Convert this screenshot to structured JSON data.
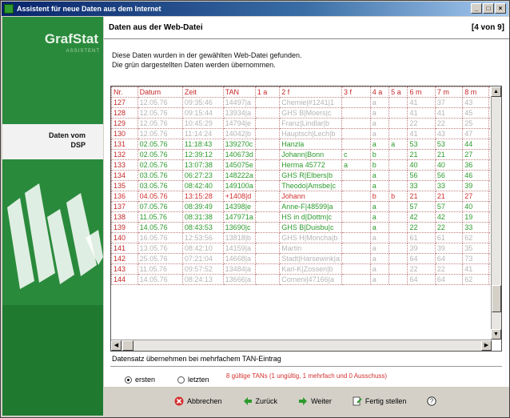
{
  "window": {
    "title": "Assistent für neue Daten aus dem Internet"
  },
  "sidebar": {
    "brand": "GrafStat",
    "sub": "ASSISTENT",
    "nav": [
      "Daten vom",
      "DSP"
    ]
  },
  "header": {
    "title": "Daten aus der Web-Datei",
    "step": "[4 von 9]"
  },
  "intro": {
    "line1": "Diese Daten wurden in der gewählten Web-Datei gefunden.",
    "line2": "Die grün dargestellten Daten werden übernommen."
  },
  "table": {
    "columns": [
      "Nr.",
      "Datum",
      "Zeit",
      "TAN",
      "1 a",
      "2 f",
      "3 f",
      "4 a",
      "5 a",
      "6 m",
      "7 m",
      "8 m",
      "9"
    ],
    "rows": [
      {
        "style": "grey",
        "cells": [
          "127",
          "12.05.76",
          "09:35:46",
          "14497|a",
          "",
          "Chemie|#1241|1",
          "",
          "a",
          "",
          "41",
          "37",
          "43",
          "4"
        ]
      },
      {
        "style": "grey",
        "cells": [
          "128",
          "12.05.76",
          "09:15:44",
          "13934|a",
          "",
          "GHS B|Moers|c",
          "",
          "a",
          "",
          "41",
          "41",
          "45",
          "4"
        ]
      },
      {
        "style": "grey",
        "cells": [
          "129",
          "12.05.76",
          "10:45:29",
          "14794|e",
          "",
          "Franz|Lindlar|b",
          "",
          "a",
          "",
          "22",
          "22",
          "25",
          "2"
        ]
      },
      {
        "style": "grey",
        "cells": [
          "130",
          "12.05.76",
          "11:14:24",
          "14042|b",
          "",
          "Hauptsch|Lech|b",
          "",
          "a",
          "",
          "41",
          "43",
          "47",
          "4"
        ]
      },
      {
        "style": "green",
        "cells": [
          "131",
          "02.05.76",
          "11:18:43",
          "139270c",
          "",
          "Hanzla",
          "",
          "a",
          "a",
          "53",
          "53",
          "44",
          "44"
        ]
      },
      {
        "style": "green",
        "cells": [
          "132",
          "02.05.76",
          "12:39:12",
          "140673d",
          "",
          "Johann|Bonn",
          "c",
          "b",
          "",
          "21",
          "21",
          "27",
          "0"
        ]
      },
      {
        "style": "green",
        "cells": [
          "133",
          "02.05.76",
          "13:07:38",
          "145075e",
          "",
          "Herma 45772",
          "a",
          "b",
          "",
          "40",
          "40",
          "36",
          "0"
        ]
      },
      {
        "style": "green",
        "cells": [
          "134",
          "03.05.76",
          "06:27:23",
          "148222a",
          "",
          "GHS R|Elbers|b",
          "",
          "a",
          "",
          "56",
          "56",
          "46",
          "4"
        ]
      },
      {
        "style": "green",
        "cells": [
          "135",
          "03.05.76",
          "08:42:40",
          "149100a",
          "",
          "Theodo|Amsbe|c",
          "",
          "a",
          "",
          "33",
          "33",
          "39",
          "3"
        ]
      },
      {
        "style": "red",
        "cells": [
          "136",
          "04.05.76",
          "13:15:28",
          "+1408|d",
          "",
          "Johann",
          "",
          "b",
          "b",
          "21",
          "21",
          "27",
          "0"
        ]
      },
      {
        "style": "green",
        "cells": [
          "137",
          "07.05.76",
          "08:39:49",
          "14398|e",
          "",
          "Anne-F|48599|a",
          "",
          "a",
          "",
          "57",
          "57",
          "40",
          "4"
        ]
      },
      {
        "style": "green",
        "cells": [
          "138",
          "11.05.76",
          "08:31:38",
          "147971a",
          "",
          "HS in d|Dottm|c",
          "",
          "a",
          "",
          "42",
          "42",
          "19",
          "1"
        ]
      },
      {
        "style": "green",
        "cells": [
          "139",
          "14.05.76",
          "08:43:53",
          "13690|c",
          "",
          "GHS B|Duisbu|c",
          "",
          "a",
          "",
          "22",
          "22",
          "33",
          "3"
        ]
      },
      {
        "style": "grey",
        "cells": [
          "140",
          "16.05.76",
          "12:53:56",
          "13818|b",
          "",
          "GHS H|Moncha|b",
          "",
          "a",
          "",
          "61",
          "61",
          "62",
          "6"
        ]
      },
      {
        "style": "grey",
        "cells": [
          "141",
          "13.05.76",
          "08:42:10",
          "14159|a",
          "",
          "Martin",
          "",
          "a",
          "",
          "39",
          "39",
          "35",
          "3"
        ]
      },
      {
        "style": "grey",
        "cells": [
          "142",
          "25.05.76",
          "07:21:04",
          "14668|a",
          "",
          "Stadt|Harsewink|a",
          "",
          "a",
          "",
          "64",
          "64",
          "73",
          "7"
        ]
      },
      {
        "style": "grey",
        "cells": [
          "143",
          "11.05.76",
          "09:57:52",
          "13484|a",
          "",
          "Karl-K|Zossen|b",
          "",
          "a",
          "",
          "22",
          "22",
          "41",
          "4"
        ]
      },
      {
        "style": "grey",
        "cells": [
          "144",
          "14.05.76",
          "08:24:13",
          "13666|a",
          "",
          "Comeni|47166|a",
          "",
          "a",
          "",
          "64",
          "64",
          "62",
          "6"
        ]
      }
    ]
  },
  "options": {
    "label": "Datensatz übernehmen bei mehrfachem TAN-Eintrag",
    "radio1": "ersten",
    "radio2": "letzten"
  },
  "status": "8 gültige TANs (1 ungültig, 1 mehrfach und 0 Ausschuss)",
  "buttons": {
    "cancel": "Abbrechen",
    "back": "Zurück",
    "next": "Weiter",
    "finish": "Fertig stellen"
  },
  "colors": {
    "sidebar": "#2a8a3c",
    "title_start": "#08246b",
    "green_text": "#2e9a2e",
    "red_text": "#d32f2f"
  }
}
